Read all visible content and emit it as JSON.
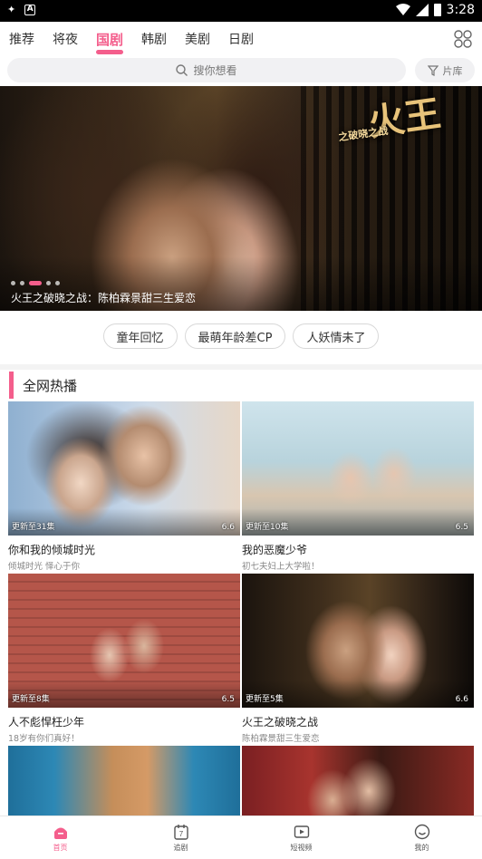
{
  "status_bar": {
    "time": "3:28"
  },
  "tabs": [
    {
      "label": "推荐",
      "active": false
    },
    {
      "label": "将夜",
      "active": false
    },
    {
      "label": "国剧",
      "active": true
    },
    {
      "label": "韩剧",
      "active": false
    },
    {
      "label": "美剧",
      "active": false
    },
    {
      "label": "日剧",
      "active": false
    }
  ],
  "search": {
    "placeholder": "搜你想看",
    "filter_label": "片库"
  },
  "banner": {
    "caption": "火王之破晓之战：陈柏霖景甜三生爱恋",
    "logo_text": "火王",
    "logo_sub": "之破晓之战",
    "page_count": 5,
    "active_page": 3
  },
  "chips": [
    "童年回忆",
    "最萌年龄差CP",
    "人妖情未了"
  ],
  "section": {
    "title": "全网热播"
  },
  "cards": [
    {
      "name": "你和我的倾城时光",
      "desc": "倾城时光 怿心于你",
      "episodes": "更新至31集",
      "score": "6.6"
    },
    {
      "name": "我的恶魔少爷",
      "desc": "初七夫妇上大学啦！",
      "episodes": "更新至10集",
      "score": "6.5"
    },
    {
      "name": "人不彪悍枉少年",
      "desc": "18岁有你们真好！",
      "episodes": "更新至8集",
      "score": "6.5"
    },
    {
      "name": "火王之破晓之战",
      "desc": "陈柏霖景甜三生爱恋",
      "episodes": "更新至5集",
      "score": "6.6"
    },
    {
      "name": "",
      "desc": "",
      "episodes": "",
      "score": ""
    },
    {
      "name": "",
      "desc": "",
      "episodes": "",
      "score": ""
    }
  ],
  "bottom_nav": [
    {
      "label": "首页",
      "icon": "home-icon",
      "active": true
    },
    {
      "label": "追剧",
      "icon": "calendar-icon",
      "active": false,
      "badge": "7"
    },
    {
      "label": "短视频",
      "icon": "play-icon",
      "active": false
    },
    {
      "label": "我的",
      "icon": "profile-icon",
      "active": false
    }
  ],
  "colors": {
    "accent": "#f45e8c"
  }
}
